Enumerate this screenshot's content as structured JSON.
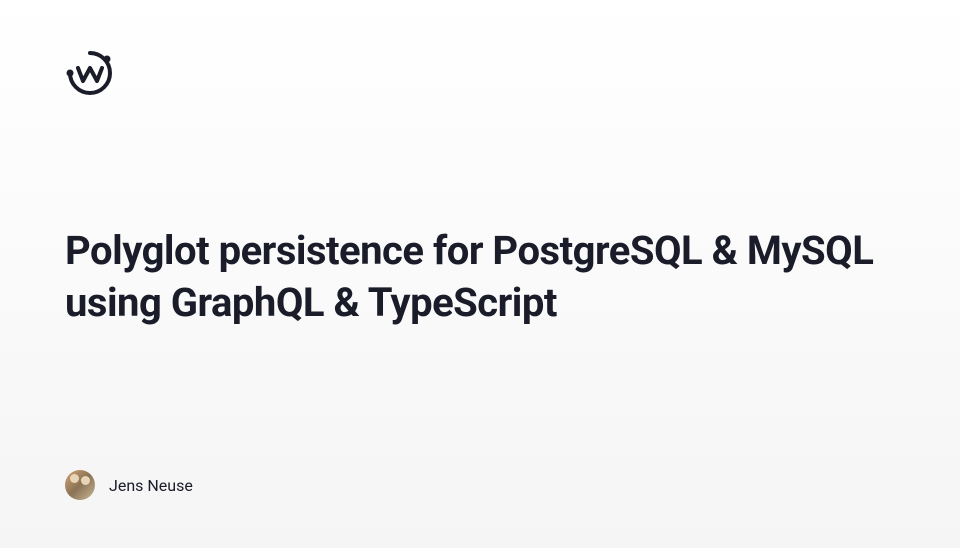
{
  "header": {
    "logo_label": "WunderGraph logo"
  },
  "main": {
    "title": "Polyglot persistence for PostgreSQL & MySQL using GraphQL & TypeScript"
  },
  "author": {
    "name": "Jens Neuse",
    "avatar_label": "Author avatar"
  }
}
